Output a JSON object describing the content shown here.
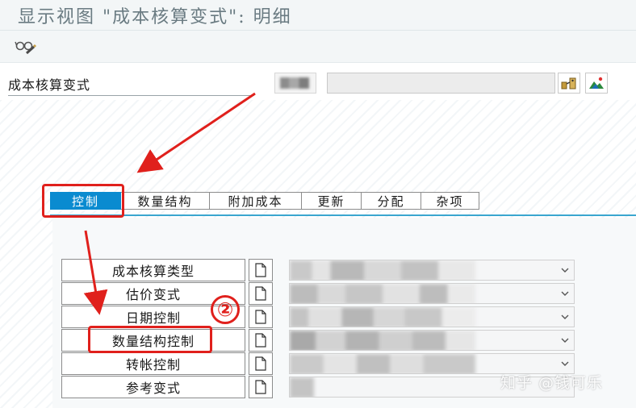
{
  "window": {
    "title": "显示视图 \"成本核算变式\": 明细"
  },
  "toolbar": {
    "items": [
      {
        "icon": "display-change-icon"
      }
    ]
  },
  "header": {
    "field_label": "成本核算变式",
    "icons": [
      "transport-icon",
      "image-icon"
    ]
  },
  "tabs": [
    {
      "label": "控制",
      "active": true
    },
    {
      "label": "数量结构",
      "active": false
    },
    {
      "label": "附加成本",
      "active": false
    },
    {
      "label": "更新",
      "active": false
    },
    {
      "label": "分配",
      "active": false
    },
    {
      "label": "杂项",
      "active": false
    }
  ],
  "rows": [
    {
      "label": "成本核算类型"
    },
    {
      "label": "估价变式"
    },
    {
      "label": "日期控制"
    },
    {
      "label": "数量结构控制"
    },
    {
      "label": "转帐控制"
    },
    {
      "label": "参考变式"
    }
  ],
  "annotation": {
    "step_number": "②"
  },
  "watermark": {
    "text": "知乎 @钱可乐"
  },
  "colors": {
    "active_tab": "#0a8bd0",
    "annotation_red": "#e0201c",
    "tab_underline": "#3aa6cf"
  }
}
